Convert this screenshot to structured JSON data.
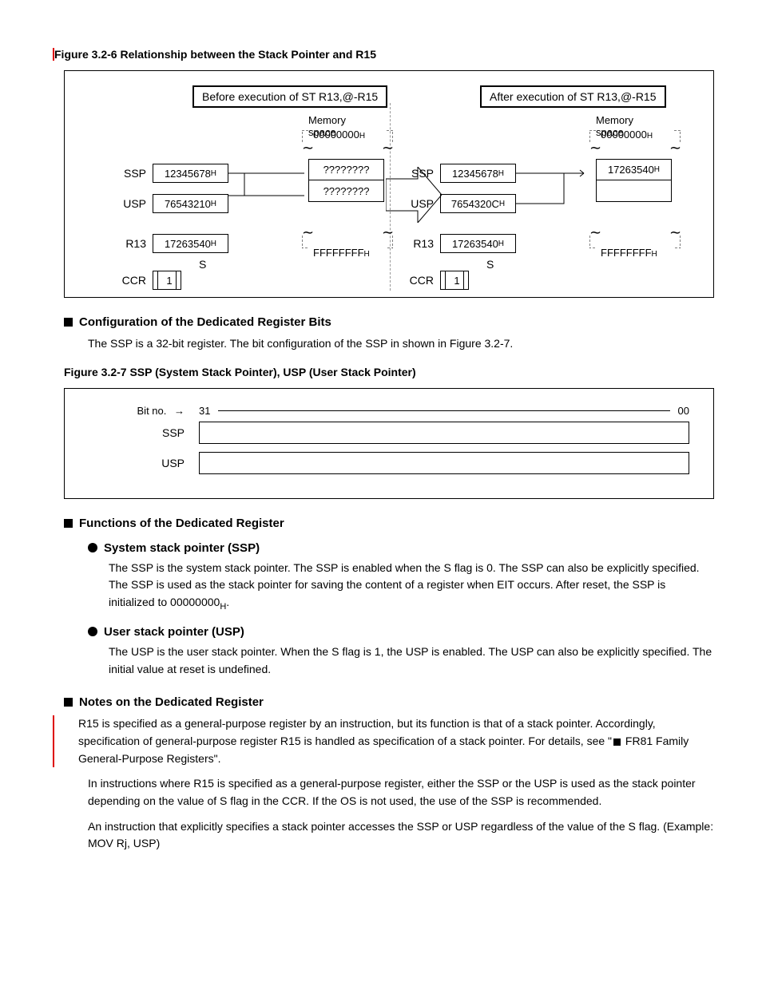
{
  "fig1": {
    "caption": "Figure 3.2-6 Relationship between the Stack Pointer and R15",
    "before_title": "Before execution of ST R13,@-R15",
    "after_title": "After execution of ST R13,@-R15",
    "mem_label": "Memory space",
    "addr_top": "00000000",
    "addr_bot": "FFFFFFFF",
    "ssp": "SSP",
    "usp": "USP",
    "r13": "R13",
    "ccr": "CCR",
    "s": "S",
    "before": {
      "ssp": "12345678",
      "usp": "76543210",
      "r13": "17263540",
      "ccr": "1",
      "mem1": "????????",
      "mem2": "????????"
    },
    "after": {
      "ssp": "12345678",
      "usp": "7654320C",
      "r13": "17263540",
      "ccr": "1",
      "mem1": "17263540",
      "mem2": ""
    },
    "h": "H"
  },
  "sec_cfg": {
    "title": "Configuration of the Dedicated Register Bits",
    "body": "The SSP is a 32-bit register. The bit configuration of the SSP in shown in Figure 3.2-7."
  },
  "fig2": {
    "caption": "Figure 3.2-7 SSP (System Stack Pointer), USP (User Stack Pointer)",
    "bitno": "Bit no.",
    "bit31": "31",
    "bit00": "00",
    "ssp": "SSP",
    "usp": "USP"
  },
  "func": {
    "title": "Functions of the Dedicated Register",
    "ssp_title": "System stack pointer (SSP)",
    "ssp_body": "The SSP is the system stack pointer. The SSP is enabled when the S flag is 0. The SSP can also be explicitly specified. The SSP is used as the stack pointer for saving the content of a register when EIT occurs. After reset, the SSP is initialized to 00000000H.",
    "usp_title": "User stack pointer (USP)",
    "usp_body": "The USP is the user stack pointer. When the S flag is 1, the USP is enabled. The USP can also be explicitly specified. The initial value at reset is undefined."
  },
  "notes": {
    "title": "Notes on the Dedicated Register",
    "body1": "R15 is specified as a general-purpose register by an instruction, but its function is that of a stack pointer. Accordingly, specification of general-purpose register R15 is handled as specification of a stack pointer. For details, see \"",
    "square": "■",
    "body2": " FR81 Family General-Purpose Registers\".",
    "body3": "In instructions where R15 is specified as a general-purpose register, either the SSP or the USP is used as the stack pointer depending on the value of S flag in the CCR. If the OS is not used, the use of the SSP is recommended.",
    "body4": "An instruction that explicitly specifies a stack pointer accesses the SSP or USP regardless of the value of the S flag. (Example: MOV Rj, USP)"
  }
}
